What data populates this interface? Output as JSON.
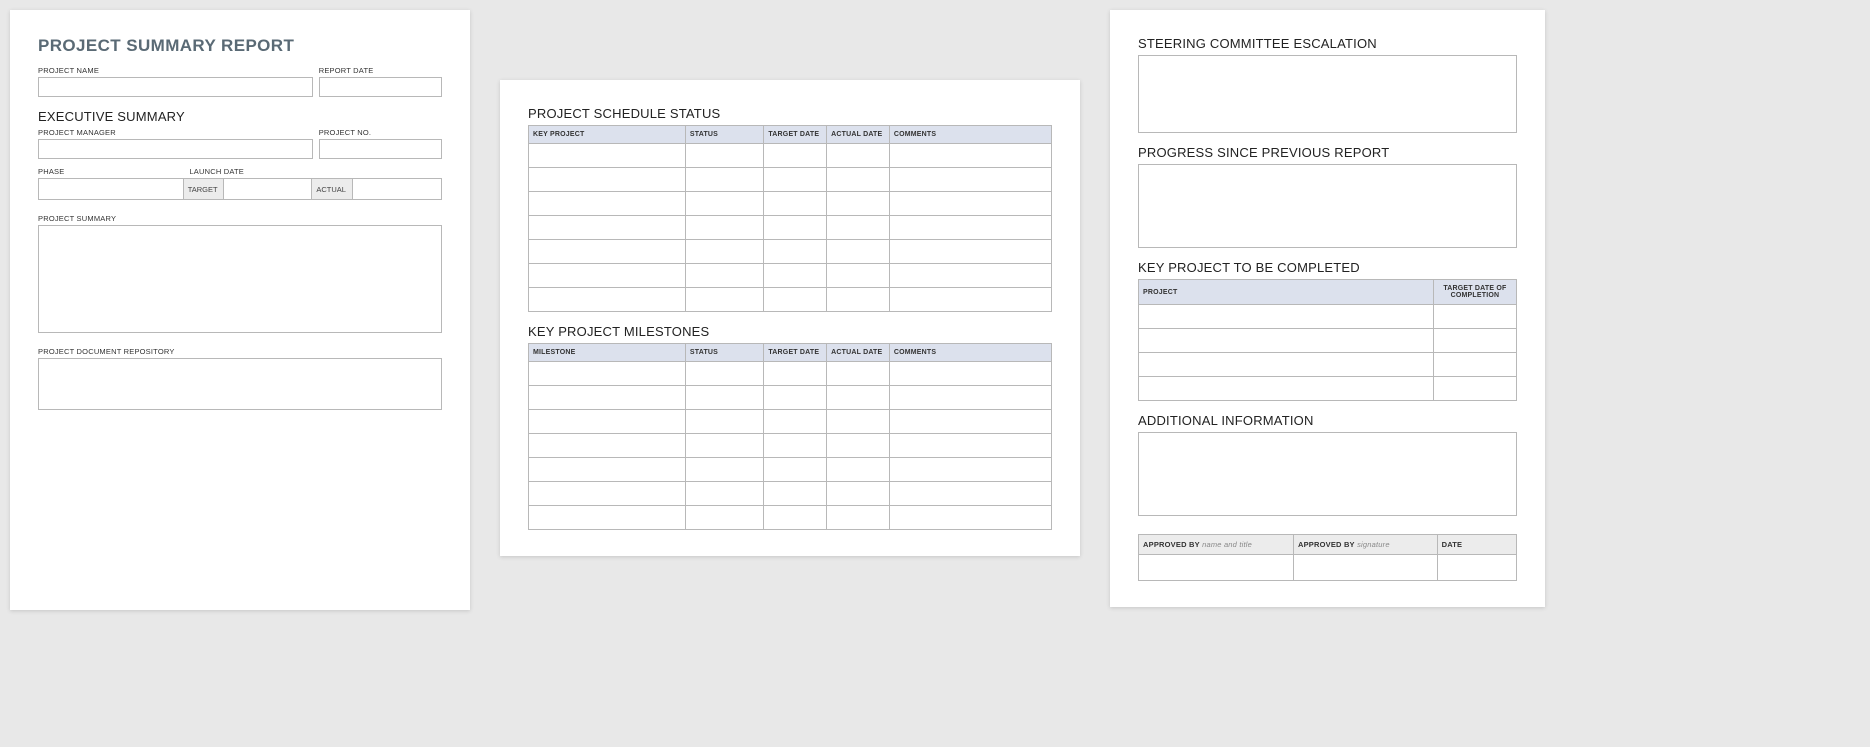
{
  "page1": {
    "title": "PROJECT SUMMARY REPORT",
    "fields": {
      "project_name": "PROJECT NAME",
      "report_date": "REPORT DATE",
      "executive_summary": "EXECUTIVE SUMMARY",
      "project_manager": "PROJECT MANAGER",
      "project_no": "PROJECT NO.",
      "phase": "PHASE",
      "launch_date": "LAUNCH DATE",
      "target": "TARGET",
      "actual": "ACTUAL",
      "project_summary": "PROJECT SUMMARY",
      "project_doc_repo": "PROJECT DOCUMENT REPOSITORY"
    }
  },
  "page2": {
    "schedule_title": "PROJECT SCHEDULE STATUS",
    "milestones_title": "KEY PROJECT MILESTONES",
    "schedule_headers": {
      "key_project": "KEY PROJECT",
      "status": "STATUS",
      "target_date": "TARGET DATE",
      "actual_date": "ACTUAL DATE",
      "comments": "COMMENTS"
    },
    "milestone_headers": {
      "milestone": "MILESTONE",
      "status": "STATUS",
      "target_date": "TARGET DATE",
      "actual_date": "ACTUAL DATE",
      "comments": "COMMENTS"
    }
  },
  "page3": {
    "steering_title": "STEERING COMMITTEE ESCALATION",
    "progress_title": "PROGRESS SINCE PREVIOUS REPORT",
    "key_project_title": "KEY PROJECT TO BE COMPLETED",
    "additional_title": "ADDITIONAL INFORMATION",
    "key_headers": {
      "project": "PROJECT",
      "target_date": "TARGET DATE OF COMPLETION"
    },
    "approval": {
      "approved_by_label": "APPROVED BY",
      "name_title": "name and title",
      "signature": "signature",
      "date": "DATE"
    }
  }
}
